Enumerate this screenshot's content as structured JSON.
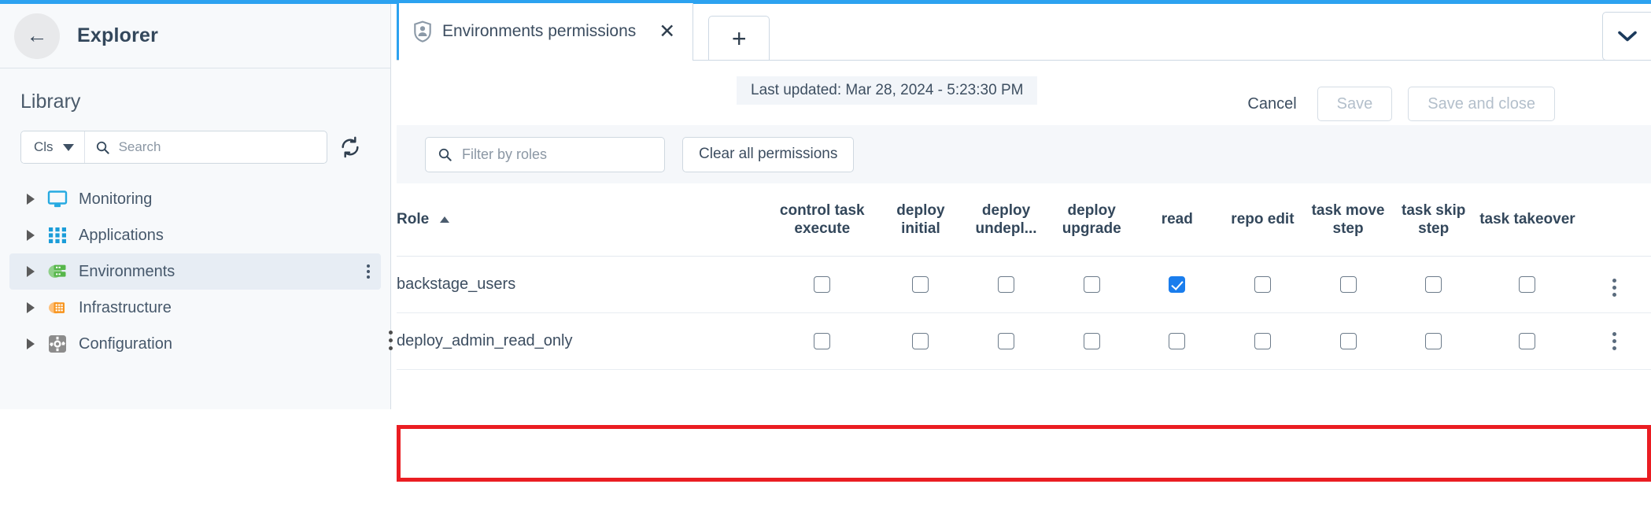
{
  "theme": {
    "accent": "#2ca2f0",
    "checkbox_checked": "#1a7ded",
    "highlight": "#ea1d22"
  },
  "explorer": {
    "back_icon": "arrow-left-icon",
    "title": "Explorer",
    "library_label": "Library",
    "search": {
      "scope_label": "Cls",
      "scope_caret_icon": "chevron-down-icon",
      "search_icon": "search-icon",
      "placeholder": "Search",
      "refresh_icon": "refresh-icon"
    },
    "tree": [
      {
        "label": "Monitoring",
        "icon": "monitor-icon",
        "selected": false,
        "expandable": true
      },
      {
        "label": "Applications",
        "icon": "grid-apps-icon",
        "selected": false,
        "expandable": true
      },
      {
        "label": "Environments",
        "icon": "servers-icon",
        "selected": true,
        "expandable": true
      },
      {
        "label": "Infrastructure",
        "icon": "infrastructure-icon",
        "selected": false,
        "expandable": true
      },
      {
        "label": "Configuration",
        "icon": "gear-icon",
        "selected": false,
        "expandable": true
      }
    ]
  },
  "tabs": {
    "items": [
      {
        "label": "Environments permissions",
        "icon": "shield-person-icon",
        "active": true,
        "close_label": "✕"
      }
    ],
    "add_label": "+",
    "overflow_icon": "chevron-down-icon"
  },
  "header": {
    "last_updated": "Last updated: Mar 28, 2024 - 5:23:30 PM",
    "cancel_label": "Cancel",
    "save_label": "Save",
    "save_and_close_label": "Save and close"
  },
  "filter": {
    "search_icon": "search-icon",
    "placeholder": "Filter by roles",
    "clear_label": "Clear all permissions"
  },
  "table": {
    "role_header": "Role",
    "sort_direction": "asc",
    "columns": [
      "control task execute",
      "deploy initial",
      "deploy undepl...",
      "deploy upgrade",
      "read",
      "repo edit",
      "task move step",
      "task skip step",
      "task takeover"
    ],
    "rows": [
      {
        "role": "backstage_users",
        "permissions": [
          false,
          false,
          false,
          false,
          true,
          false,
          false,
          false,
          false
        ],
        "highlighted": true
      },
      {
        "role": "deploy_admin_read_only",
        "permissions": [
          false,
          false,
          false,
          false,
          false,
          false,
          false,
          false,
          false
        ],
        "highlighted": false
      }
    ],
    "row_menu_icon": "kebab-menu-icon"
  }
}
